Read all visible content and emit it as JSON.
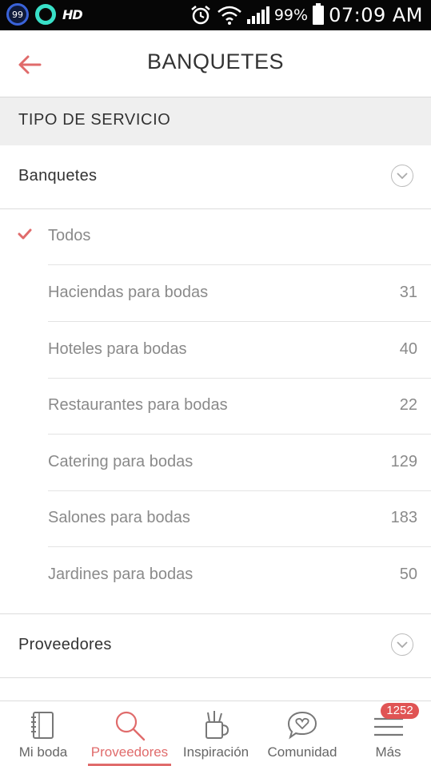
{
  "status_bar": {
    "notif_badge": "99",
    "hd": "HD",
    "battery": "99%",
    "time": "07:09 AM"
  },
  "header": {
    "title": "BANQUETES"
  },
  "section": {
    "title": "TIPO DE SERVICIO"
  },
  "categories": [
    {
      "label": "Banquetes"
    },
    {
      "label": "Proveedores"
    }
  ],
  "subcategories": [
    {
      "label": "Todos",
      "count": "",
      "selected": true
    },
    {
      "label": "Haciendas para bodas",
      "count": "31"
    },
    {
      "label": "Hoteles para bodas",
      "count": "40"
    },
    {
      "label": "Restaurantes para bodas",
      "count": "22"
    },
    {
      "label": "Catering para bodas",
      "count": "129"
    },
    {
      "label": "Salones para bodas",
      "count": "183"
    },
    {
      "label": "Jardines para bodas",
      "count": "50"
    }
  ],
  "bottom_nav": {
    "items": [
      {
        "label": "Mi boda",
        "icon": "notebook-icon"
      },
      {
        "label": "Proveedores",
        "icon": "search-icon",
        "active": true
      },
      {
        "label": "Inspiración",
        "icon": "pencil-cup-icon"
      },
      {
        "label": "Comunidad",
        "icon": "chat-heart-icon"
      },
      {
        "label": "Más",
        "icon": "menu-icon"
      }
    ],
    "notification_count": "1252"
  },
  "colors": {
    "accent": "#e06b6b",
    "text_dark": "#333333",
    "text_muted": "#8a8a8a",
    "section_bg": "#efefef"
  }
}
